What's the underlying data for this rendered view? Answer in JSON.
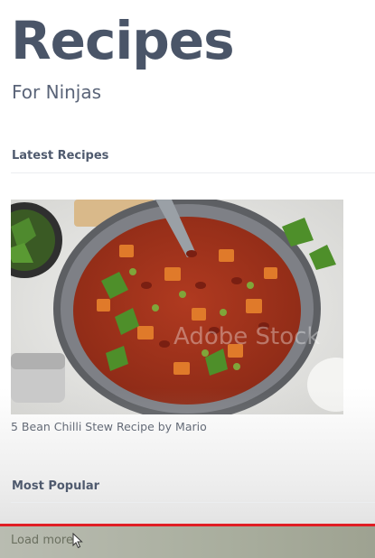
{
  "header": {
    "title": "Recipes",
    "subtitle": "For Ninjas"
  },
  "sections": {
    "latest_heading": "Latest Recipes",
    "popular_heading": "Most Popular"
  },
  "latest_recipe": {
    "caption": "5 Bean Chilli Stew Recipe by Mario",
    "image_watermark": "Adobe Stock"
  },
  "load_more": {
    "label": "Load more"
  },
  "colors": {
    "heading": "#4a5568",
    "progress_bar": "#e01e24",
    "divider": "#ebedf0"
  },
  "icons": {
    "cursor": "pointer-cursor-icon"
  }
}
